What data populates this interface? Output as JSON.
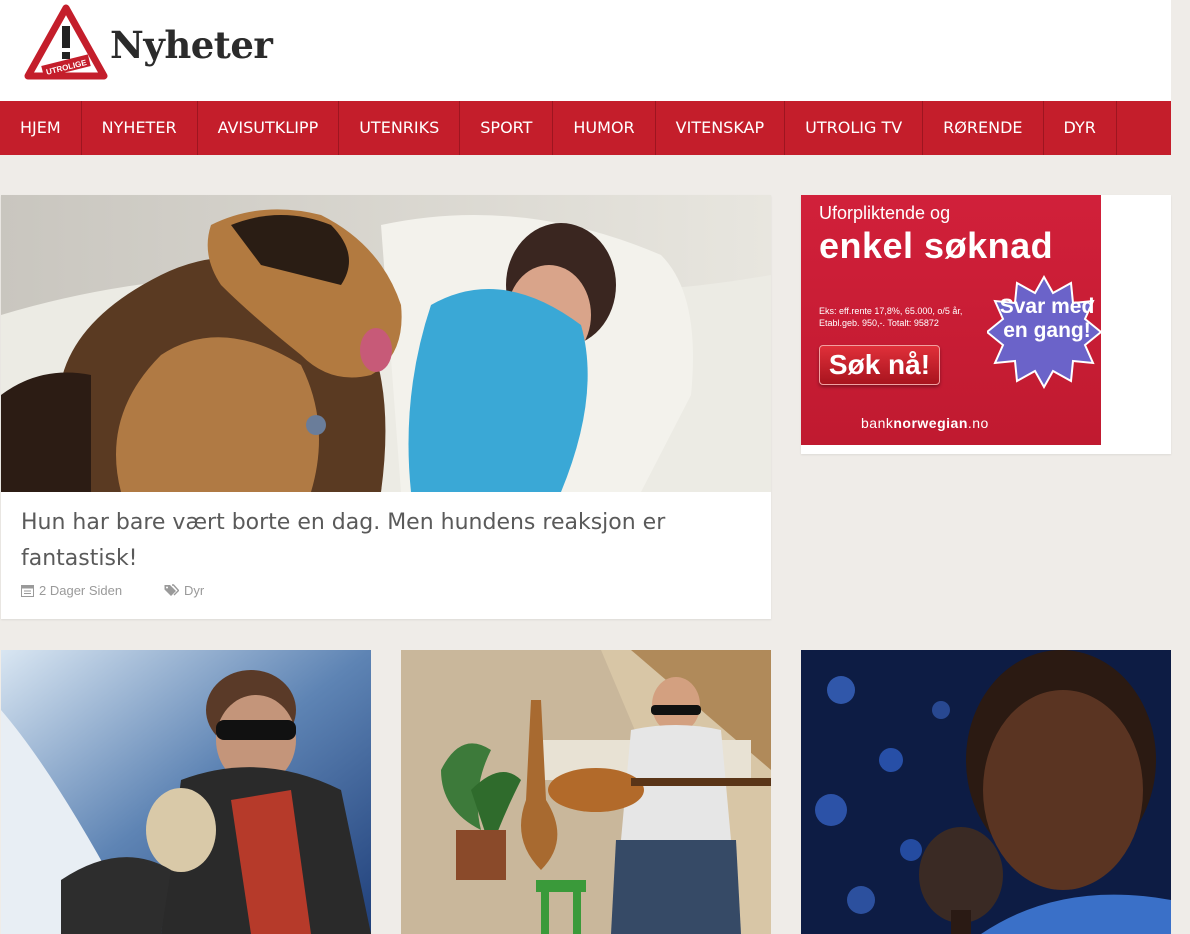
{
  "header": {
    "logo_badge": "UTROLIGE",
    "logo_text": "Nyheter"
  },
  "nav": {
    "items": [
      {
        "label": "HJEM"
      },
      {
        "label": "NYHETER"
      },
      {
        "label": "AVISUTKLIPP"
      },
      {
        "label": "UTENRIKS"
      },
      {
        "label": "SPORT"
      },
      {
        "label": "HUMOR"
      },
      {
        "label": "VITENSKAP"
      },
      {
        "label": "UTROLIG TV"
      },
      {
        "label": "RØRENDE"
      },
      {
        "label": "DYR"
      }
    ]
  },
  "feature": {
    "image_icon": "photo-icon",
    "title": "Hun har bare vært borte en dag. Men hundens reaksjon er fantastisk!",
    "date": "2 Dager Siden",
    "date_icon": "calendar-icon",
    "category": "Dyr",
    "category_icon": "tags-icon"
  },
  "ad": {
    "line1": "Uforpliktende og",
    "line2": "enkel søknad",
    "fine_print": "Eks: eff.rente 17,8%, 65.000, o/5 år, Etabl.geb. 950,-. Totalt: 95872",
    "cta": "Søk nå!",
    "burst": "Svar med en gang!",
    "brand_prefix": "bank",
    "brand_bold": "norwegian",
    "brand_suffix": ".no",
    "colors": {
      "background": "#c41e2b",
      "burst": "#6b63c9"
    }
  },
  "colors": {
    "accent": "#c41e2b",
    "page_bg": "#efece8"
  }
}
